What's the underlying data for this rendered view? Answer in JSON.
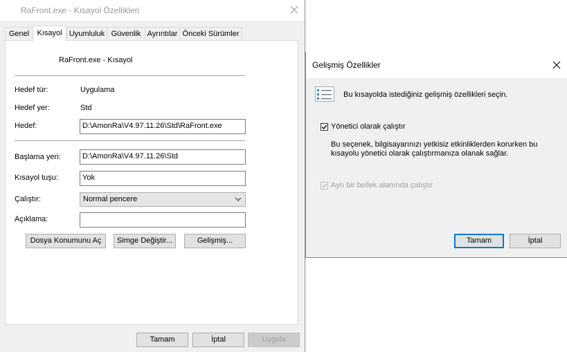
{
  "main_window": {
    "title": "RaFront.exe - Kısayol Özellikleri",
    "tabs": [
      "Genel",
      "Kısayol",
      "Uyumluluk",
      "Güvenlik",
      "Ayrıntılar",
      "Önceki Sürümler"
    ],
    "active_tab": "Kısayol",
    "shortcut_name": "RaFront.exe - Kısayol",
    "target_type_label": "Hedef tür:",
    "target_type_value": "Uygulama",
    "target_location_label": "Hedef yer:",
    "target_location_value": "Std",
    "target_label": "Hedef:",
    "target_value": "D:\\AmonRa\\V4.97.11.26\\Std\\RaFront.exe",
    "start_in_label": "Başlama yeri:",
    "start_in_value": "D:\\AmonRa\\V4.97.11.26\\Std",
    "shortcut_key_label": "Kısayol tuşu:",
    "shortcut_key_value": "Yok",
    "run_label": "Çalıştır:",
    "run_value": "Normal pencere",
    "comment_label": "Açıklama:",
    "comment_value": "",
    "open_location_button": "Dosya Konumunu Aç",
    "change_icon_button": "Simge Değiştir...",
    "advanced_button": "Gelişmiş...",
    "ok_button": "Tamam",
    "cancel_button": "İptal",
    "apply_button": "Uygula"
  },
  "advanced_dialog": {
    "title": "Gelişmiş Özellikler",
    "description": "Bu kısayolda istediğiniz gelişmiş özellikleri seçin.",
    "run_as_admin_label": "Yönetici olarak çalıştır",
    "run_as_admin_checked": true,
    "run_as_admin_help_line1": "Bu seçenek, bilgisayarınızı yetkisiz etkinliklerden korurken bu",
    "run_as_admin_help_line2": "kısayolu yönetici olarak çalıştırmanıza olanak sağlar.",
    "separate_memory_label": "Ayrı bir bellek alanında çalıştır",
    "separate_memory_checked": true,
    "separate_memory_enabled": false,
    "ok_button": "Tamam",
    "cancel_button": "İptal"
  }
}
